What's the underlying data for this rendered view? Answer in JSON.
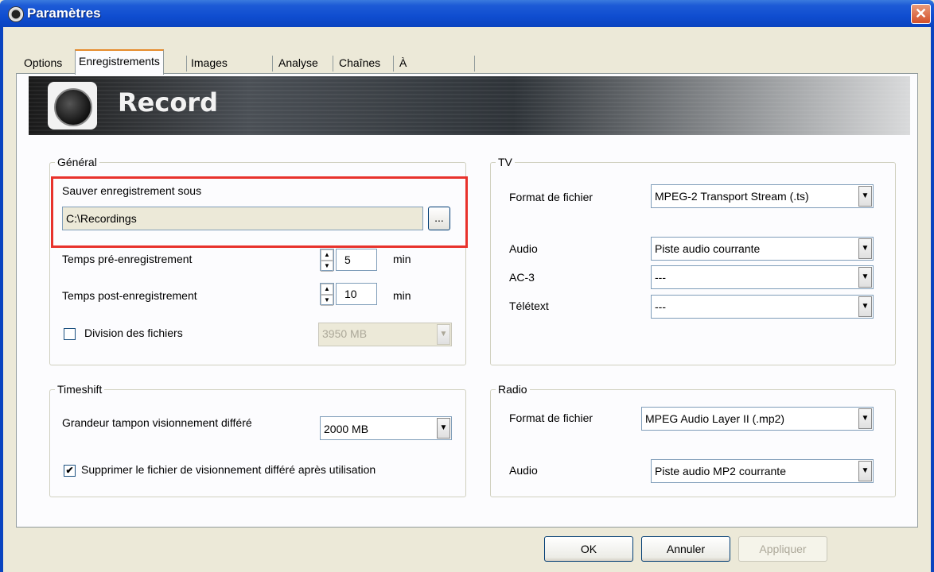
{
  "window": {
    "title": "Paramètres",
    "close_symbol": "✕"
  },
  "tabs": [
    "Options",
    "Enregistrements",
    "Images fixes",
    "Analyse",
    "Chaînes",
    "À propos de"
  ],
  "active_tab": "Enregistrements",
  "banner": {
    "title": "Record"
  },
  "general": {
    "legend": "Général",
    "save_label": "Sauver enregistrement sous",
    "save_path": "C:\\Recordings",
    "browse_label": "...",
    "pre_label": "Temps pré-enregistrement",
    "pre_value": "5",
    "pre_unit": "min",
    "post_label": "Temps post-enregistrement",
    "post_value": "10",
    "post_unit": "min",
    "split_label": "Division des fichiers",
    "split_checked": false,
    "split_size": "3950 MB"
  },
  "timeshift": {
    "legend": "Timeshift",
    "buffer_label": "Grandeur tampon visionnement différé",
    "buffer_value": "2000 MB",
    "delete_label": "Supprimer le fichier de visionnement différé après utilisation",
    "delete_checked": true
  },
  "tv": {
    "legend": "TV",
    "format_label": "Format de fichier",
    "format_value": "MPEG-2 Transport Stream (.ts)",
    "audio_label": "Audio",
    "audio_value": "Piste audio courrante",
    "ac3_label": "AC-3",
    "ac3_value": "---",
    "teletext_label": "Télétext",
    "teletext_value": "---"
  },
  "radio": {
    "legend": "Radio",
    "format_label": "Format de fichier",
    "format_value": "MPEG Audio Layer II (.mp2)",
    "audio_label": "Audio",
    "audio_value": "Piste audio MP2 courrante"
  },
  "buttons": {
    "ok": "OK",
    "cancel": "Annuler",
    "apply": "Appliquer"
  },
  "colors": {
    "highlight": "#e8322c",
    "titlebar": "#0f4dd0"
  }
}
